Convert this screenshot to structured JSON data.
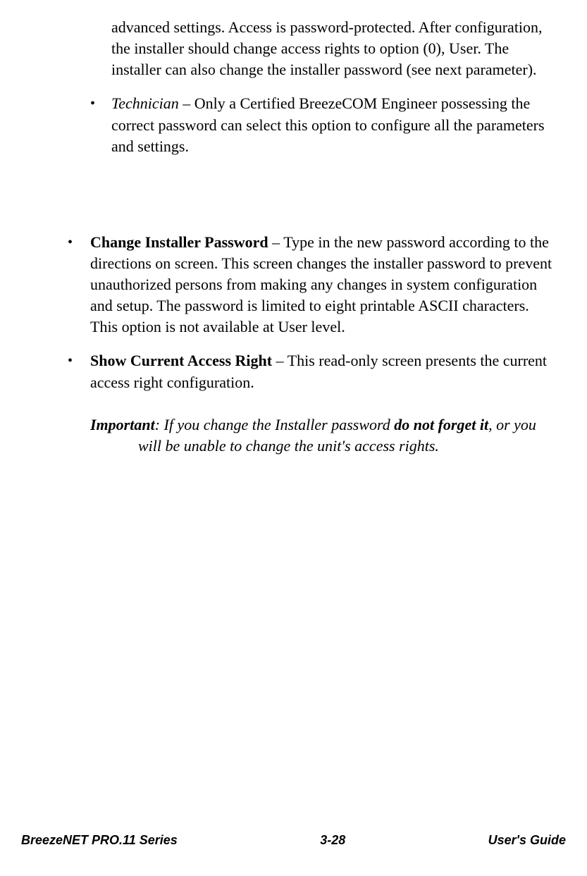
{
  "content": {
    "continued_para": "advanced settings. Access is password-protected. After configuration, the installer should change access rights to option (0), User. The installer can also change the installer password (see next parameter).",
    "technician_label": "Technician",
    "technician_text": " – Only a Certified BreezeCOM Engineer possessing the correct password can select this option to configure all the parameters and settings.",
    "change_password_label": "Change Installer Password",
    "change_password_text": " – Type in the new password according to the directions on screen. This screen changes the installer password to prevent unauthorized persons from making any changes in system configuration and setup. The password is limited to eight printable ASCII characters. This option is not available at User level.",
    "show_access_label": "Show Current Access Right",
    "show_access_text": " – This read-only screen presents the current access right configuration.",
    "important_label": "Important",
    "important_text_1": ": If you change the Installer password ",
    "important_bold": "do not forget it",
    "important_text_2": ", or you will be unable to change the unit's access rights."
  },
  "footer": {
    "left": "BreezeNET PRO.11 Series",
    "center": "3-28",
    "right": "User's Guide"
  }
}
